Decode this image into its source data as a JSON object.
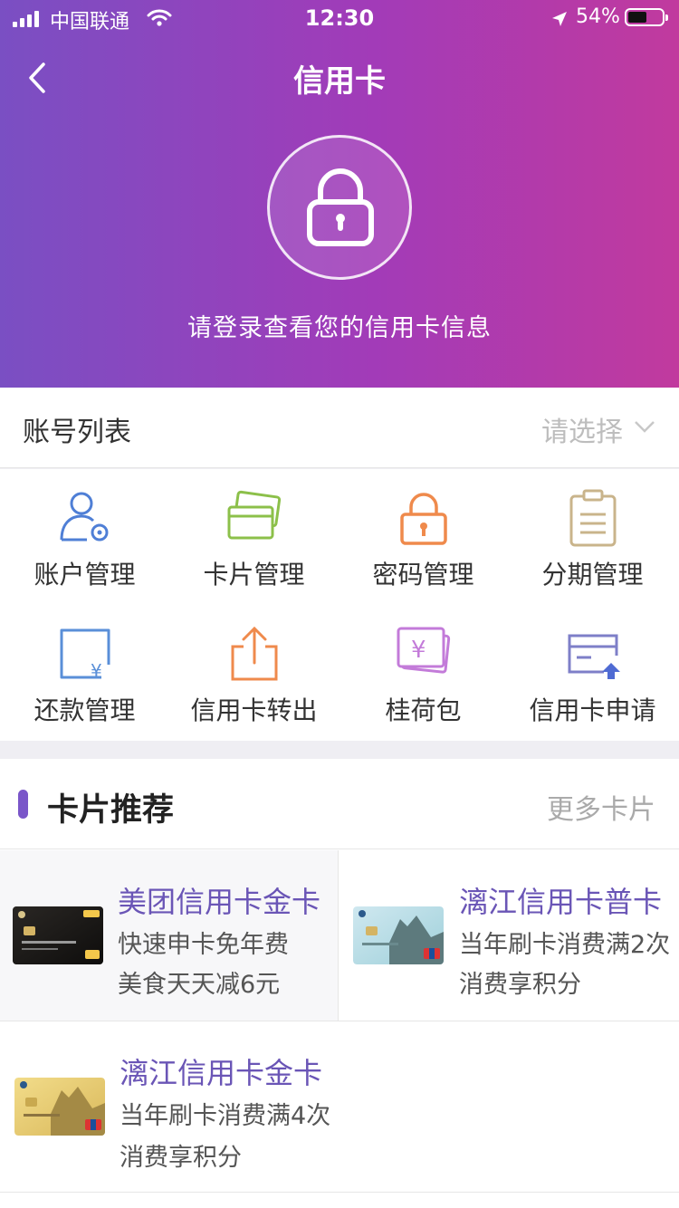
{
  "status_bar": {
    "carrier": "中国联通",
    "time": "12:30",
    "battery": "54%"
  },
  "header": {
    "title": "信用卡",
    "login_prompt": "请登录查看您的信用卡信息"
  },
  "account": {
    "label": "账号列表",
    "select_placeholder": "请选择"
  },
  "menu": [
    {
      "label": "账户管理",
      "icon": "account-settings-icon"
    },
    {
      "label": "卡片管理",
      "icon": "cards-icon"
    },
    {
      "label": "密码管理",
      "icon": "lock-icon"
    },
    {
      "label": "分期管理",
      "icon": "clipboard-icon"
    },
    {
      "label": "还款管理",
      "icon": "repayment-icon"
    },
    {
      "label": "信用卡转出",
      "icon": "share-out-icon"
    },
    {
      "label": "桂荷包",
      "icon": "wallet-yen-icon"
    },
    {
      "label": "信用卡申请",
      "icon": "card-apply-icon"
    }
  ],
  "recommend": {
    "title": "卡片推荐",
    "more": "更多卡片",
    "cards": [
      {
        "name": "美团信用卡金卡",
        "line1": "快速申卡免年费",
        "line2": "美食天天减6元"
      },
      {
        "name": "漓江信用卡普卡",
        "line1": "当年刷卡消费满2次",
        "line2": "消费享积分"
      },
      {
        "name": "漓江信用卡金卡",
        "line1": "当年刷卡消费满4次",
        "line2": "消费享积分"
      }
    ]
  },
  "colors": {
    "accent": "#7a56c9",
    "gradient_start": "#7a4fc3",
    "gradient_end": "#c13a9e"
  }
}
